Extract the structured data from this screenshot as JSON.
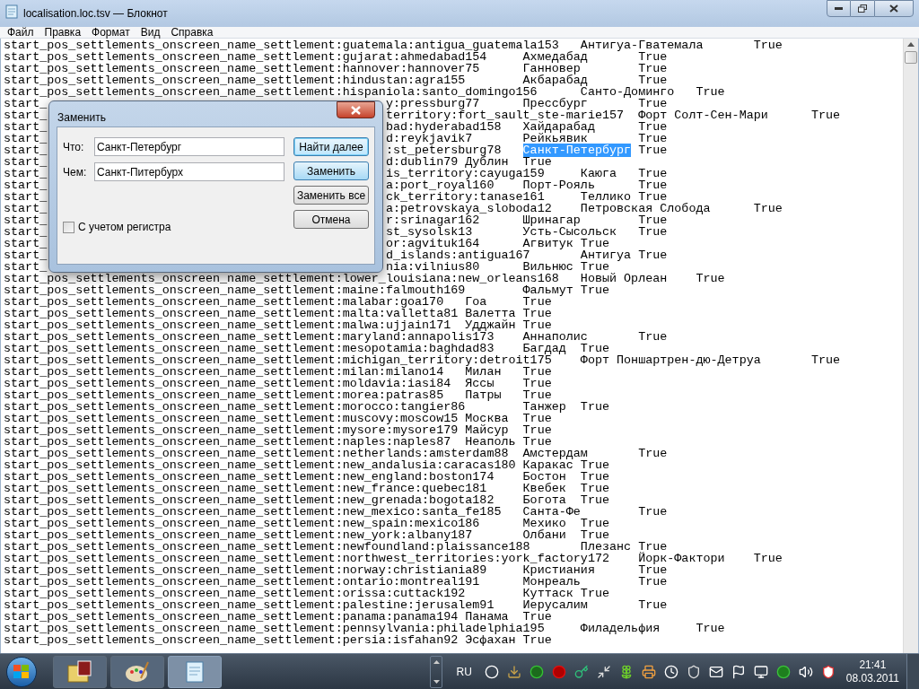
{
  "window": {
    "title": "localisation.loc.tsv — Блокнот"
  },
  "menu": [
    "Файл",
    "Правка",
    "Формат",
    "Вид",
    "Справка"
  ],
  "lines": [
    {
      "parts": [
        {
          "kind": "text",
          "text": "start_pos_settlements_onscreen_name_settlement:guatemala:antigua_guatemala153\tАнтигуа-Гватемала\tTrue"
        }
      ]
    },
    {
      "parts": [
        {
          "kind": "text",
          "text": "start_pos_settlements_onscreen_name_settlement:gujarat:ahmedabad154\tАхмедабад\tTrue"
        }
      ]
    },
    {
      "parts": [
        {
          "kind": "text",
          "text": "start_pos_settlements_onscreen_name_settlement:hannover:hannover75\tГанновер\tTrue"
        }
      ]
    },
    {
      "parts": [
        {
          "kind": "text",
          "text": "start_pos_settlements_onscreen_name_settlement:hindustan:agra155\tАкбарабад\tTrue"
        }
      ]
    },
    {
      "parts": [
        {
          "kind": "text",
          "text": "start_pos_settlements_onscreen_name_settlement:hispaniola:santo_domingo156\tСанто-Доминго\tTrue"
        }
      ]
    },
    {
      "parts": [
        {
          "kind": "text",
          "text": "start_"
        },
        {
          "kind": "gap"
        },
        {
          "kind": "text",
          "text": "y:pressburg77\tПрессбург\tTrue"
        }
      ]
    },
    {
      "parts": [
        {
          "kind": "text",
          "text": "start_"
        },
        {
          "kind": "gap"
        },
        {
          "kind": "text",
          "text": "territory:fort_sault_ste-marie157\tФорт Солт-Сен-Мари\tTrue"
        }
      ]
    },
    {
      "parts": [
        {
          "kind": "text",
          "text": "start_"
        },
        {
          "kind": "gap"
        },
        {
          "kind": "text",
          "text": "bad:hyderabad158\tХайдарабад\tTrue"
        }
      ]
    },
    {
      "parts": [
        {
          "kind": "text",
          "text": "start_"
        },
        {
          "kind": "gap"
        },
        {
          "kind": "text",
          "text": "d:reykjavik7\tРейкьявик\tTrue"
        }
      ]
    },
    {
      "parts": [
        {
          "kind": "text",
          "text": "start_"
        },
        {
          "kind": "gap"
        },
        {
          "kind": "text",
          "text": ":st_petersburg78\t"
        },
        {
          "kind": "selection",
          "text": "Санкт-Петербург"
        },
        {
          "kind": "text",
          "text": "\tTrue"
        }
      ]
    },
    {
      "parts": [
        {
          "kind": "text",
          "text": "start_"
        },
        {
          "kind": "gap"
        },
        {
          "kind": "text",
          "text": "d:dublin79\tДублин\tTrue"
        }
      ]
    },
    {
      "parts": [
        {
          "kind": "text",
          "text": "start_"
        },
        {
          "kind": "gap"
        },
        {
          "kind": "text",
          "text": "is_territory:cayuga159\tКаюга\tTrue"
        }
      ]
    },
    {
      "parts": [
        {
          "kind": "text",
          "text": "start_"
        },
        {
          "kind": "gap"
        },
        {
          "kind": "text",
          "text": "a:port_royal160\tПорт-Рояль\tTrue"
        }
      ]
    },
    {
      "parts": [
        {
          "kind": "text",
          "text": "start_"
        },
        {
          "kind": "gap"
        },
        {
          "kind": "text",
          "text": "ck_territory:tanase161\tТеллико\tTrue"
        }
      ]
    },
    {
      "parts": [
        {
          "kind": "text",
          "text": "start_"
        },
        {
          "kind": "gap"
        },
        {
          "kind": "text",
          "text": "a:petrovskaya_sloboda12\tПетровская Слобода\tTrue"
        }
      ]
    },
    {
      "parts": [
        {
          "kind": "text",
          "text": "start_"
        },
        {
          "kind": "gap"
        },
        {
          "kind": "text",
          "text": "r:srinagar162\tШринагар\tTrue"
        }
      ]
    },
    {
      "parts": [
        {
          "kind": "text",
          "text": "start_"
        },
        {
          "kind": "gap"
        },
        {
          "kind": "text",
          "text": "st_sysolsk13\tУсть-Сысольск\tTrue"
        }
      ]
    },
    {
      "parts": [
        {
          "kind": "text",
          "text": "start_"
        },
        {
          "kind": "gap"
        },
        {
          "kind": "text",
          "text": "or:agvituk164\tАгвитук\tTrue"
        }
      ]
    },
    {
      "parts": [
        {
          "kind": "text",
          "text": "start_"
        },
        {
          "kind": "gap"
        },
        {
          "kind": "text",
          "text": "d_islands:antigua167\tАнтигуа\tTrue"
        }
      ]
    },
    {
      "parts": [
        {
          "kind": "text",
          "text": "start_"
        },
        {
          "kind": "gap"
        },
        {
          "kind": "text",
          "text": "nia:vilnius80\tВильнюс\tTrue"
        }
      ]
    },
    {
      "parts": [
        {
          "kind": "text",
          "text": "start_pos_settlements_onscreen_name_settlement:lower_louisiana:new_orleans168\tНовый Орлеан\tTrue"
        }
      ]
    },
    {
      "parts": [
        {
          "kind": "text",
          "text": "start_pos_settlements_onscreen_name_settlement:maine:falmouth169\tФальмут\tTrue"
        }
      ]
    },
    {
      "parts": [
        {
          "kind": "text",
          "text": "start_pos_settlements_onscreen_name_settlement:malabar:goa170\tГоа\tTrue"
        }
      ]
    },
    {
      "parts": [
        {
          "kind": "text",
          "text": "start_pos_settlements_onscreen_name_settlement:malta:valletta81\tВалетта\tTrue"
        }
      ]
    },
    {
      "parts": [
        {
          "kind": "text",
          "text": "start_pos_settlements_onscreen_name_settlement:malwa:ujjain171\tУдджайн\tTrue"
        }
      ]
    },
    {
      "parts": [
        {
          "kind": "text",
          "text": "start_pos_settlements_onscreen_name_settlement:maryland:annapolis173\tАннаполис\tTrue"
        }
      ]
    },
    {
      "parts": [
        {
          "kind": "text",
          "text": "start_pos_settlements_onscreen_name_settlement:mesopotamia:baghdad83\tБагдад\tTrue"
        }
      ]
    },
    {
      "parts": [
        {
          "kind": "text",
          "text": "start_pos_settlements_onscreen_name_settlement:michigan_territory:detroit175\tФорт Поншартрен-дю-Детруа\tTrue"
        }
      ]
    },
    {
      "parts": [
        {
          "kind": "text",
          "text": "start_pos_settlements_onscreen_name_settlement:milan:milano14\tМилан\tTrue"
        }
      ]
    },
    {
      "parts": [
        {
          "kind": "text",
          "text": "start_pos_settlements_onscreen_name_settlement:moldavia:iasi84\tЯссы\tTrue"
        }
      ]
    },
    {
      "parts": [
        {
          "kind": "text",
          "text": "start_pos_settlements_onscreen_name_settlement:morea:patras85\tПатры\tTrue"
        }
      ]
    },
    {
      "parts": [
        {
          "kind": "text",
          "text": "start_pos_settlements_onscreen_name_settlement:morocco:tangier86\tТанжер\tTrue"
        }
      ]
    },
    {
      "parts": [
        {
          "kind": "text",
          "text": "start_pos_settlements_onscreen_name_settlement:muscovy:moscow15\tМосква\tTrue"
        }
      ]
    },
    {
      "parts": [
        {
          "kind": "text",
          "text": "start_pos_settlements_onscreen_name_settlement:mysore:mysore179\tМайсур\tTrue"
        }
      ]
    },
    {
      "parts": [
        {
          "kind": "text",
          "text": "start_pos_settlements_onscreen_name_settlement:naples:naples87\tНеаполь\tTrue"
        }
      ]
    },
    {
      "parts": [
        {
          "kind": "text",
          "text": "start_pos_settlements_onscreen_name_settlement:netherlands:amsterdam88\tАмстердам\tTrue"
        }
      ]
    },
    {
      "parts": [
        {
          "kind": "text",
          "text": "start_pos_settlements_onscreen_name_settlement:new_andalusia:caracas180\tКаракас\tTrue"
        }
      ]
    },
    {
      "parts": [
        {
          "kind": "text",
          "text": "start_pos_settlements_onscreen_name_settlement:new_england:boston174\tБостон\tTrue"
        }
      ]
    },
    {
      "parts": [
        {
          "kind": "text",
          "text": "start_pos_settlements_onscreen_name_settlement:new_france:quebec181\tКвебек\tTrue"
        }
      ]
    },
    {
      "parts": [
        {
          "kind": "text",
          "text": "start_pos_settlements_onscreen_name_settlement:new_grenada:bogota182\tБогота\tTrue"
        }
      ]
    },
    {
      "parts": [
        {
          "kind": "text",
          "text": "start_pos_settlements_onscreen_name_settlement:new_mexico:santa_fe185\tСанта-Фе\tTrue"
        }
      ]
    },
    {
      "parts": [
        {
          "kind": "text",
          "text": "start_pos_settlements_onscreen_name_settlement:new_spain:mexico186\tМехико\tTrue"
        }
      ]
    },
    {
      "parts": [
        {
          "kind": "text",
          "text": "start_pos_settlements_onscreen_name_settlement:new_york:albany187\tОлбани\tTrue"
        }
      ]
    },
    {
      "parts": [
        {
          "kind": "text",
          "text": "start_pos_settlements_onscreen_name_settlement:newfoundland:plaissance188\tПлезанс\tTrue"
        }
      ]
    },
    {
      "parts": [
        {
          "kind": "text",
          "text": "start_pos_settlements_onscreen_name_settlement:northwest_territories:york_factory172\tЙорк-Фактори\tTrue"
        }
      ]
    },
    {
      "parts": [
        {
          "kind": "text",
          "text": "start_pos_settlements_onscreen_name_settlement:norway:christiania89\tКристиания\tTrue"
        }
      ]
    },
    {
      "parts": [
        {
          "kind": "text",
          "text": "start_pos_settlements_onscreen_name_settlement:ontario:montreal191\tМонреаль\tTrue"
        }
      ]
    },
    {
      "parts": [
        {
          "kind": "text",
          "text": "start_pos_settlements_onscreen_name_settlement:orissa:cuttack192\tКуттаск\tTrue"
        }
      ]
    },
    {
      "parts": [
        {
          "kind": "text",
          "text": "start_pos_settlements_onscreen_name_settlement:palestine:jerusalem91\tИерусалим\tTrue"
        }
      ]
    },
    {
      "parts": [
        {
          "kind": "text",
          "text": "start_pos_settlements_onscreen_name_settlement:panama:panama194\tПанама\tTrue"
        }
      ]
    },
    {
      "parts": [
        {
          "kind": "text",
          "text": "start_pos_settlements_onscreen_name_settlement:pennsylvania:philadelphia195\tФиладельфия\tTrue"
        }
      ]
    },
    {
      "parts": [
        {
          "kind": "text",
          "text": "start_pos_settlements_onscreen_name_settlement:persia:isfahan92\tЭсфахан\tTrue"
        }
      ]
    }
  ],
  "dialog": {
    "title": "Заменить",
    "fields": [
      {
        "label": "Что:",
        "value": "Санкт-Петербург"
      },
      {
        "label": "Чем:",
        "value": "Санкт-Питербурх"
      }
    ],
    "buttons": [
      {
        "label": "Найти далее",
        "kind": "default"
      },
      {
        "label": "Заменить",
        "kind": "hot"
      },
      {
        "label": "Заменить все",
        "kind": "normal"
      },
      {
        "label": "Отмена",
        "kind": "normal"
      }
    ],
    "checkbox": {
      "label": "С учетом регистра",
      "checked": false
    }
  },
  "taskbar": {
    "language": "RU",
    "time": "21:41",
    "date": "08.03.2011"
  }
}
